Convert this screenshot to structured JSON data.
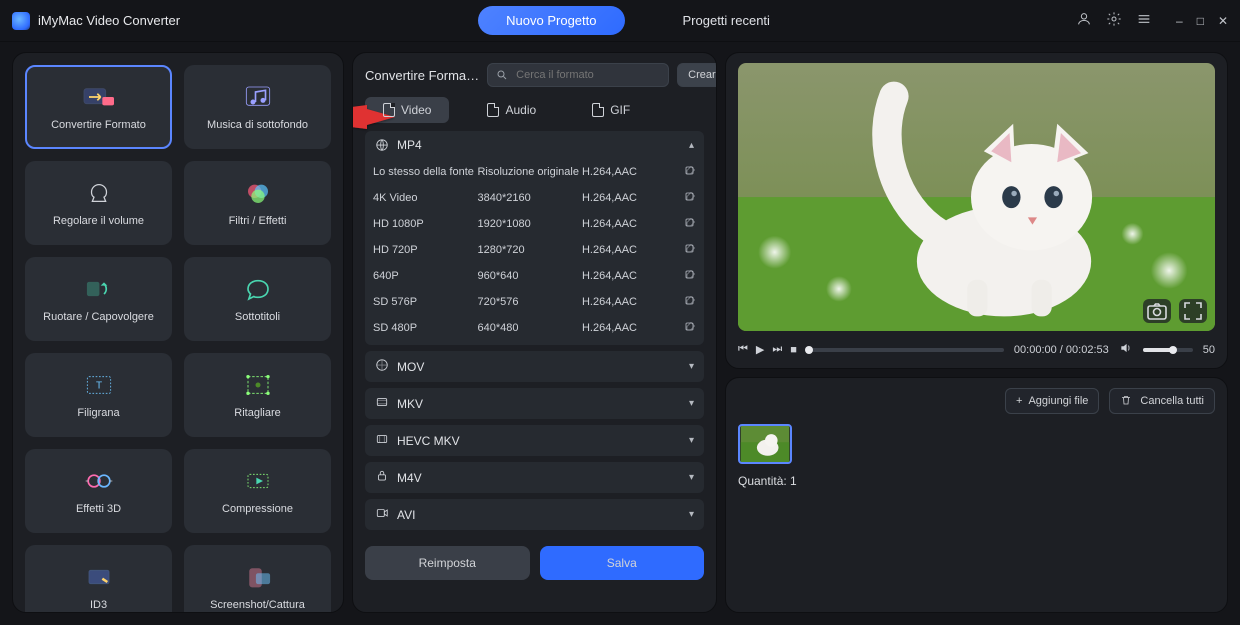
{
  "app": {
    "title": "iMyMac Video Converter"
  },
  "tabs": {
    "new_project": "Nuovo Progetto",
    "recent_projects": "Progetti recenti"
  },
  "window_controls": {
    "user": "user",
    "settings": "settings",
    "menu": "menu",
    "min": "–",
    "max": "□",
    "close": "✕"
  },
  "tools": [
    {
      "id": "convert-format",
      "label": "Convertire Formato",
      "active": true
    },
    {
      "id": "bg-music",
      "label": "Musica di sottofondo"
    },
    {
      "id": "adjust-volume",
      "label": "Regolare il volume"
    },
    {
      "id": "filters-effects",
      "label": "Filtri / Effetti"
    },
    {
      "id": "rotate-flip",
      "label": "Ruotare / Capovolgere"
    },
    {
      "id": "subtitles",
      "label": "Sottotitoli"
    },
    {
      "id": "watermark",
      "label": "Filigrana"
    },
    {
      "id": "crop",
      "label": "Ritagliare"
    },
    {
      "id": "3d-effects",
      "label": "Effetti 3D"
    },
    {
      "id": "compression",
      "label": "Compressione"
    },
    {
      "id": "id3",
      "label": "ID3"
    },
    {
      "id": "screenshot",
      "label": "Screenshot/Cattura"
    }
  ],
  "mid": {
    "title": "Convertire Forma…",
    "search_placeholder": "Cerca il formato",
    "create_btn": "Creare",
    "tabs": {
      "video": "Video",
      "audio": "Audio",
      "gif": "GIF"
    },
    "mp4_header": "MP4",
    "mp4_rows": [
      {
        "name": "Lo stesso della fonte",
        "res": "Risoluzione originale",
        "codec": "H.264,AAC"
      },
      {
        "name": "4K Video",
        "res": "3840*2160",
        "codec": "H.264,AAC"
      },
      {
        "name": "HD 1080P",
        "res": "1920*1080",
        "codec": "H.264,AAC"
      },
      {
        "name": "HD 720P",
        "res": "1280*720",
        "codec": "H.264,AAC"
      },
      {
        "name": "640P",
        "res": "960*640",
        "codec": "H.264,AAC"
      },
      {
        "name": "SD 576P",
        "res": "720*576",
        "codec": "H.264,AAC"
      },
      {
        "name": "SD 480P",
        "res": "640*480",
        "codec": "H.264,AAC"
      }
    ],
    "collapsed": [
      "MOV",
      "MKV",
      "HEVC MKV",
      "M4V",
      "AVI"
    ],
    "reset_btn": "Reimposta",
    "save_btn": "Salva"
  },
  "preview": {
    "current_time": "00:00:00",
    "duration": "00:02:53",
    "time_sep": " / ",
    "volume": "50"
  },
  "files": {
    "add_btn": "Aggiungi file",
    "clear_btn": "Cancella tutti",
    "qty_label": "Quantità:",
    "qty_value": "1"
  }
}
